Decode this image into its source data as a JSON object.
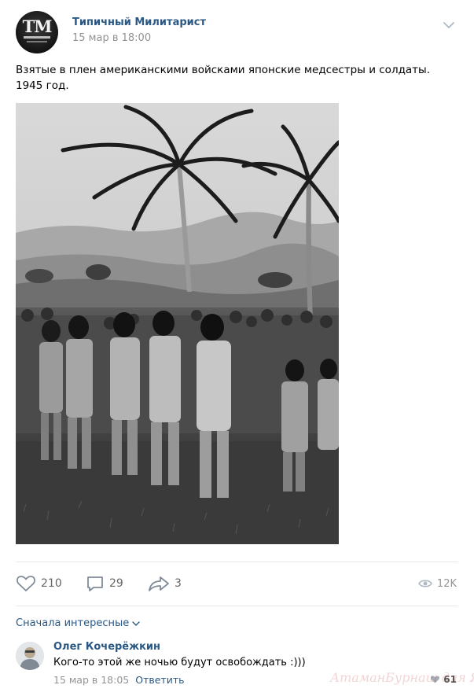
{
  "post": {
    "author": "Типичный Милитарист",
    "avatar_text": "TM",
    "date": "15 мар в 18:00",
    "text": "Взятые в плен американскими войсками японские медсестры и солдаты. 1945 год."
  },
  "actions": {
    "likes": "210",
    "comments": "29",
    "shares": "3",
    "views": "12K"
  },
  "icons": {
    "menu": "chevron-down-icon",
    "like": "heart-icon",
    "comment": "comment-icon",
    "share": "share-icon",
    "views": "eye-icon",
    "sort": "chevron-down-icon",
    "comment_like": "heart-icon"
  },
  "comments": {
    "sort_label": "Сначала интересные",
    "items": [
      {
        "author": "Олег Кочерёжкин",
        "text": "Кого-то этой же ночью будут освобождать :)))",
        "date": "15 мар в 18:05",
        "reply_label": "Ответить",
        "likes": "61"
      }
    ]
  },
  "watermark": "АтаманБурнаш для ЯП",
  "colors": {
    "link": "#2a5885",
    "muted": "#939393",
    "divider": "#e7e8ec",
    "icon": "#818c99"
  }
}
